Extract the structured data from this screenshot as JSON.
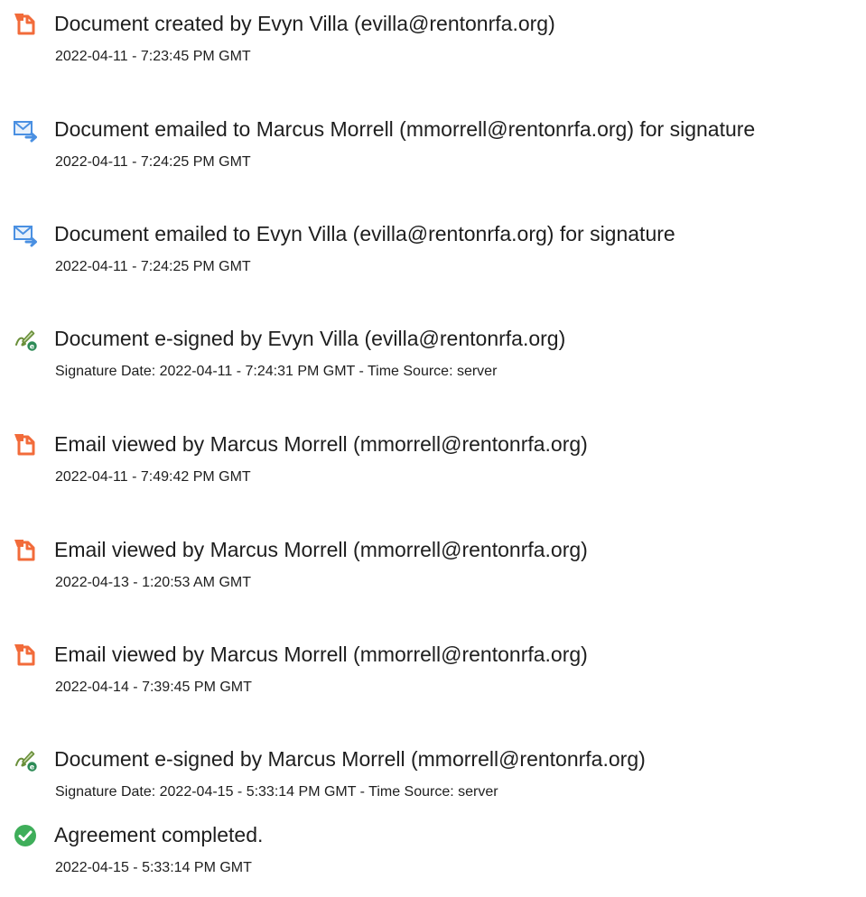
{
  "colors": {
    "doc_icon": "#f26b3a",
    "email_icon": "#4a90e2",
    "sign_icon": "#5a8a3c",
    "complete_icon": "#3fae5a",
    "text": "#1e1e1e"
  },
  "events": [
    {
      "icon": "document-icon",
      "title": "Document created by Evyn Villa (evilla@rentonrfa.org)",
      "subtitle": "2022-04-11 - 7:23:45 PM GMT"
    },
    {
      "icon": "email-icon",
      "title": "Document emailed to Marcus Morrell (mmorrell@rentonrfa.org) for signature",
      "subtitle": "2022-04-11 - 7:24:25 PM GMT"
    },
    {
      "icon": "email-icon",
      "title": "Document emailed to Evyn Villa (evilla@rentonrfa.org) for signature",
      "subtitle": "2022-04-11 - 7:24:25 PM GMT"
    },
    {
      "icon": "esign-icon",
      "title": "Document e-signed by Evyn Villa (evilla@rentonrfa.org)",
      "subtitle": "Signature Date: 2022-04-11 - 7:24:31 PM GMT - Time Source: server"
    },
    {
      "icon": "document-icon",
      "title": "Email viewed by Marcus Morrell (mmorrell@rentonrfa.org)",
      "subtitle": "2022-04-11 - 7:49:42 PM GMT"
    },
    {
      "icon": "document-icon",
      "title": "Email viewed by Marcus Morrell (mmorrell@rentonrfa.org)",
      "subtitle": "2022-04-13 - 1:20:53 AM GMT"
    },
    {
      "icon": "document-icon",
      "title": "Email viewed by Marcus Morrell (mmorrell@rentonrfa.org)",
      "subtitle": "2022-04-14 - 7:39:45 PM GMT"
    },
    {
      "icon": "esign-icon",
      "title": "Document e-signed by Marcus Morrell (mmorrell@rentonrfa.org)",
      "subtitle": "Signature Date: 2022-04-15 - 5:33:14 PM GMT - Time Source: server"
    },
    {
      "icon": "check-circle-icon",
      "title": "Agreement completed.",
      "subtitle": "2022-04-15 - 5:33:14 PM GMT"
    }
  ]
}
